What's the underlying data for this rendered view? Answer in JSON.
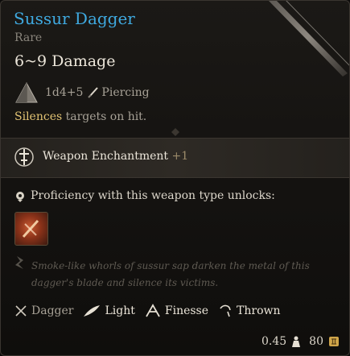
{
  "item": {
    "name": "Sussur Dagger",
    "rarity": "Rare",
    "damage_range": "6~9 Damage",
    "damage_dice": "1d4+5",
    "damage_type": "Piercing",
    "special_keyword": "Silences",
    "special_rest": " targets on hit."
  },
  "enchantment": {
    "label": "Weapon Enchantment",
    "bonus": "+1"
  },
  "proficiency": {
    "label": "Proficiency with this weapon type unlocks:"
  },
  "flavor": "Smoke-like whorls of sussur sap darken the metal of this dagger's blade and silence its victims.",
  "properties": [
    {
      "label": "Dagger",
      "icon": "dagger-icon"
    },
    {
      "label": "Light",
      "icon": "feather-icon"
    },
    {
      "label": "Finesse",
      "icon": "finesse-icon"
    },
    {
      "label": "Thrown",
      "icon": "thrown-icon"
    }
  ],
  "footer": {
    "weight": "0.45",
    "value": "80"
  },
  "colors": {
    "title": "#3fa9e0",
    "keyword": "#e2c373",
    "text": "#ece6da",
    "muted": "#a7a196"
  }
}
